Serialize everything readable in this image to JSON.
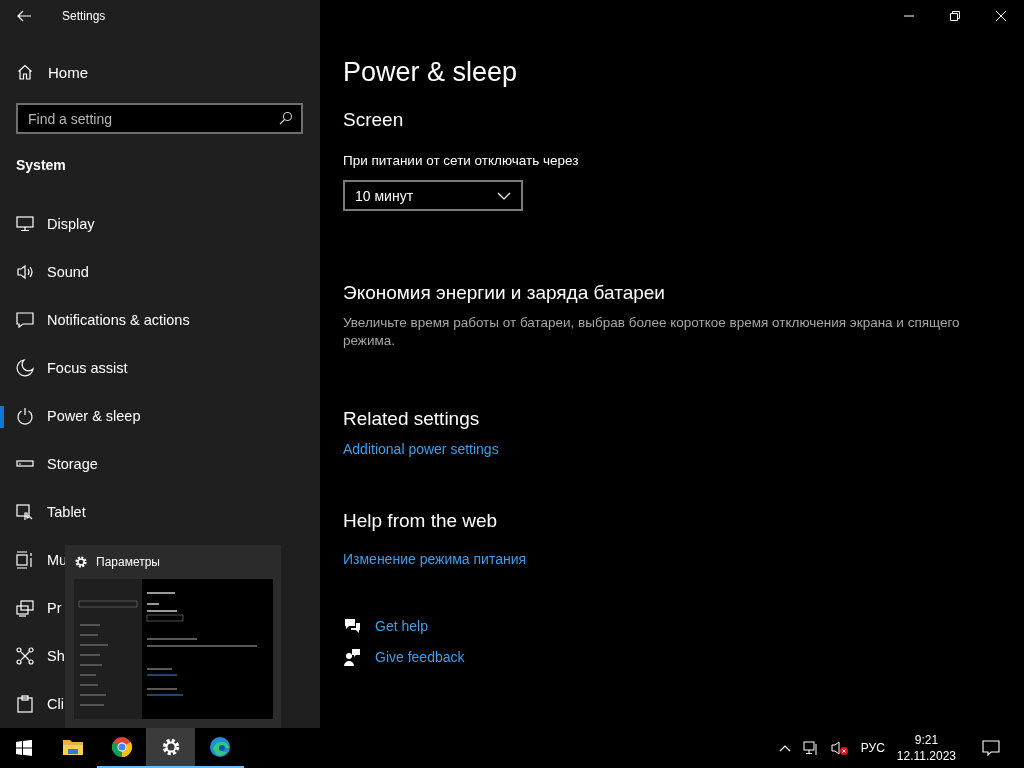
{
  "window": {
    "title": "Settings"
  },
  "sidebar": {
    "home": "Home",
    "search": {
      "placeholder": "Find a setting"
    },
    "section": "System",
    "items": [
      {
        "label": "Display",
        "selected": false
      },
      {
        "label": "Sound",
        "selected": false
      },
      {
        "label": "Notifications & actions",
        "selected": false
      },
      {
        "label": "Focus assist",
        "selected": false
      },
      {
        "label": "Power & sleep",
        "selected": true
      },
      {
        "label": "Storage",
        "selected": false
      },
      {
        "label": "Tablet",
        "selected": false
      },
      {
        "label": "Mu",
        "selected": false
      },
      {
        "label": "Pr",
        "selected": false
      },
      {
        "label": "Sh",
        "selected": false
      },
      {
        "label": "Cli",
        "selected": false
      }
    ]
  },
  "main": {
    "title": "Power & sleep",
    "screen": {
      "heading": "Screen",
      "label": "При питании от сети отключать через",
      "value": "10 минут"
    },
    "battery_saving": {
      "heading": "Экономия энергии и заряда батареи",
      "description": "Увеличьте время работы от батареи, выбрав более короткое время отключения экрана и спящего режима."
    },
    "related": {
      "heading": "Related settings",
      "link": "Additional power settings"
    },
    "help": {
      "heading": "Help from the web",
      "link": "Изменение режима питания"
    },
    "actions": [
      "Get help",
      "Give feedback"
    ]
  },
  "task_preview": {
    "title": "Параметры"
  },
  "taskbar": {
    "apps": [
      {
        "running": false,
        "selected": false
      },
      {
        "running": true,
        "selected": false
      },
      {
        "running": true,
        "selected": true
      },
      {
        "running": true,
        "selected": false
      }
    ],
    "language": "РУС",
    "time": "9:21",
    "date": "12.11.2023"
  }
}
